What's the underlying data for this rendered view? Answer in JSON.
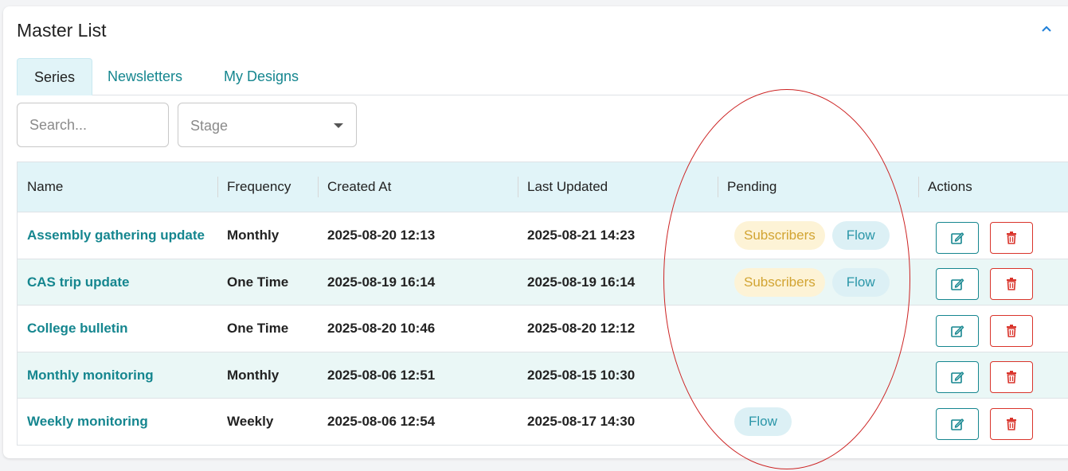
{
  "card": {
    "title": "Master List"
  },
  "tabs": [
    {
      "label": "Series"
    },
    {
      "label": "Newsletters"
    },
    {
      "label": "My Designs"
    }
  ],
  "filters": {
    "search_placeholder": "Search...",
    "stage_placeholder": "Stage"
  },
  "table": {
    "headers": {
      "name": "Name",
      "frequency": "Frequency",
      "created_at": "Created At",
      "last_updated": "Last Updated",
      "pending": "Pending",
      "actions": "Actions"
    },
    "rows": [
      {
        "name": "Assembly gathering update",
        "frequency": "Monthly",
        "created_at": "2025-08-20 12:13",
        "last_updated": "2025-08-21 14:23",
        "pending": [
          "Subscribers",
          "Flow"
        ]
      },
      {
        "name": "CAS trip update",
        "frequency": "One Time",
        "created_at": "2025-08-19 16:14",
        "last_updated": "2025-08-19 16:14",
        "pending": [
          "Subscribers",
          "Flow"
        ]
      },
      {
        "name": "College bulletin",
        "frequency": "One Time",
        "created_at": "2025-08-20 10:46",
        "last_updated": "2025-08-20 12:12",
        "pending": []
      },
      {
        "name": "Monthly monitoring",
        "frequency": "Monthly",
        "created_at": "2025-08-06 12:51",
        "last_updated": "2025-08-15 10:30",
        "pending": []
      },
      {
        "name": "Weekly monitoring",
        "frequency": "Weekly",
        "created_at": "2025-08-06 12:54",
        "last_updated": "2025-08-17 14:30",
        "pending": [
          "Flow"
        ]
      }
    ]
  },
  "colors": {
    "accent": "#15868f",
    "danger": "#d9342b",
    "header_bg": "#e1f4f8",
    "alt_row_bg": "#eaf7f6",
    "subscribers_badge": "#fdf3d6",
    "flow_badge": "#dcf0f5",
    "annotation": "#cc2222"
  },
  "icons": {
    "collapse": "chevron-up-icon",
    "edit": "edit-icon",
    "delete": "trash-icon",
    "stage_dropdown": "caret-down-icon"
  }
}
